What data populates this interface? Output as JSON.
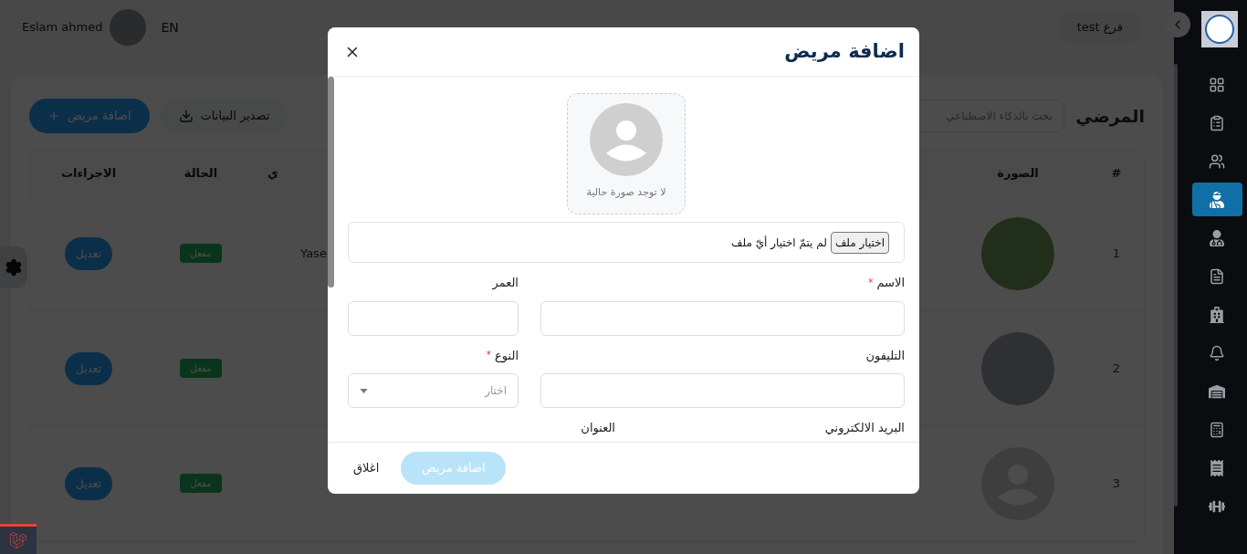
{
  "header": {
    "user_name": "Eslam ahmed",
    "language": "EN",
    "branch": "فرع test"
  },
  "sidebar": {
    "items": [
      {
        "kind": "grid",
        "selected": false
      },
      {
        "kind": "clipboard",
        "selected": false
      },
      {
        "kind": "users",
        "selected": false
      },
      {
        "kind": "patient",
        "selected": true
      },
      {
        "kind": "doctor",
        "selected": false
      },
      {
        "kind": "file",
        "selected": false
      },
      {
        "kind": "building",
        "selected": false
      },
      {
        "kind": "bell",
        "selected": false
      },
      {
        "kind": "warehouse",
        "selected": false
      },
      {
        "kind": "calculator",
        "selected": false
      },
      {
        "kind": "receipt",
        "selected": false
      },
      {
        "kind": "dumbbell",
        "selected": false
      }
    ]
  },
  "patients": {
    "title": "المرضي",
    "search": {
      "placeholder": "بحث بالذكاء الاصطناعي"
    },
    "export_button": "تصدير البيانات",
    "add_button": "اضافة مريض",
    "table": {
      "columns": [
        "#",
        "الصورة",
        "ي",
        "الحالة",
        "الاجراءات"
      ],
      "rows": [
        {
          "number": "1",
          "photo": {
            "kind": "photo"
          },
          "name": "Yase",
          "status": "مفعل",
          "action": "تعديل"
        },
        {
          "number": "2",
          "photo": {
            "kind": "photo"
          },
          "status": "مفعل",
          "action": "تعديل"
        },
        {
          "number": "3",
          "photo": {
            "kind": "default"
          },
          "status": "مفعل",
          "action": "تعديل"
        }
      ]
    }
  },
  "modal": {
    "title": "اضافة مريض",
    "image_caption": "لا توجد صورة حالية",
    "file_button": "اختيار ملف",
    "file_status": "لم يتمّ اختيار أيّ ملف",
    "rows": [
      {
        "kind": "pair",
        "fields": [
          {
            "label": "الاسم",
            "required_mark": "*",
            "kind": "text"
          },
          {
            "label": "العمر",
            "kind": "text"
          }
        ]
      },
      {
        "kind": "pair",
        "fields": [
          {
            "label": "التليفون",
            "kind": "text"
          },
          {
            "label": "النوع",
            "required_mark": "*",
            "kind": "select",
            "placeholder": "اختار"
          }
        ]
      },
      {
        "kind": "halves",
        "fields": [
          {
            "label": "البريد الالكتروني"
          },
          {
            "label": "العنوان"
          }
        ]
      }
    ],
    "submit_button": {
      "label": "اضافة مريض",
      "disabled": true
    },
    "close_button": "اغلاق"
  }
}
